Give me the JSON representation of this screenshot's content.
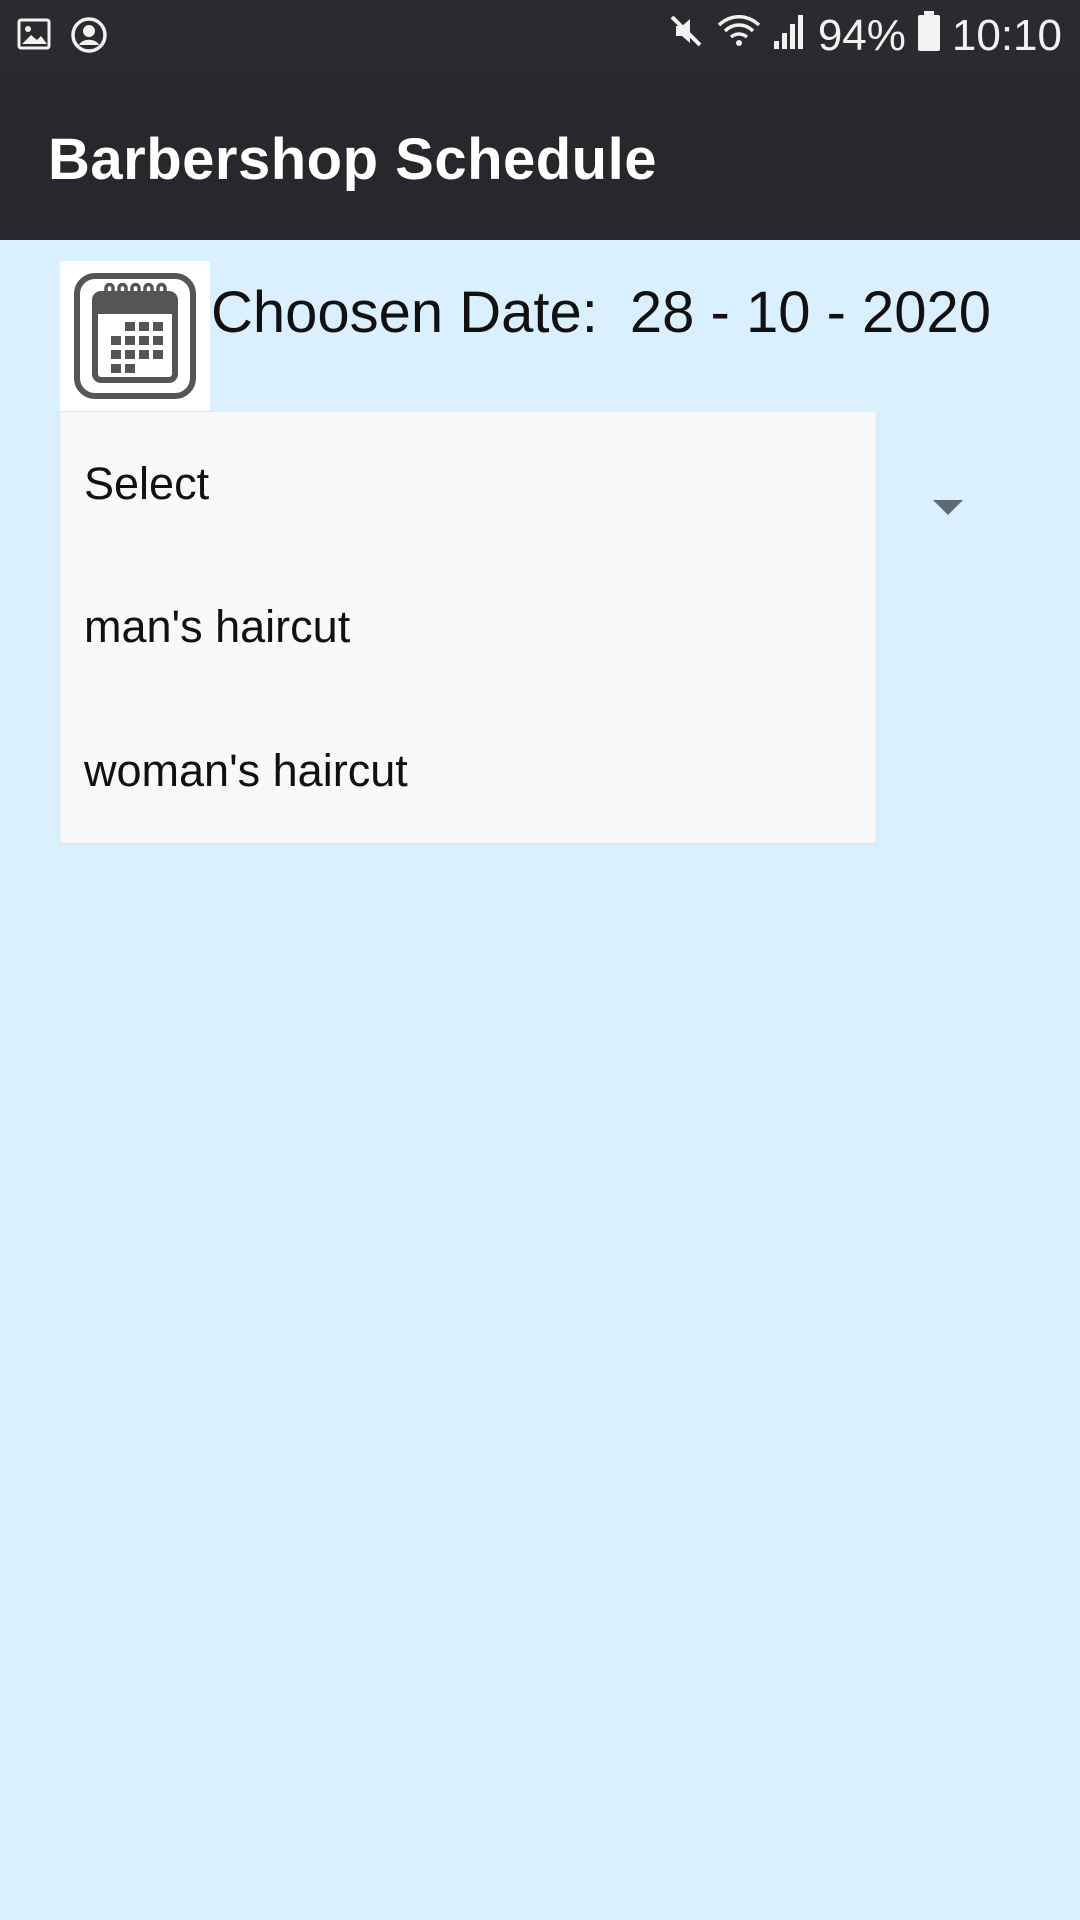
{
  "status_bar": {
    "left_icons": [
      "image-notification-icon",
      "account-circle-icon"
    ],
    "right_icons": [
      "mute-icon",
      "wifi-icon",
      "signal-icon",
      "battery-icon"
    ],
    "battery_percent": "94%",
    "time": "10:10"
  },
  "app_bar": {
    "title": "Barbershop Schedule"
  },
  "date_row": {
    "icon": "calendar-icon",
    "label": "Choosen Date:",
    "value": "28 - 10 - 2020"
  },
  "dropdown": {
    "options": [
      "Select",
      "man's haircut",
      "woman's haircut"
    ],
    "arrow_icon": "dropdown-arrow-icon"
  },
  "colors": {
    "status_bar_bg": "#2a2b2f",
    "app_bar_bg": "#27282c",
    "page_bg": "#dbf0fe",
    "popup_bg": "#f9f9f9"
  }
}
